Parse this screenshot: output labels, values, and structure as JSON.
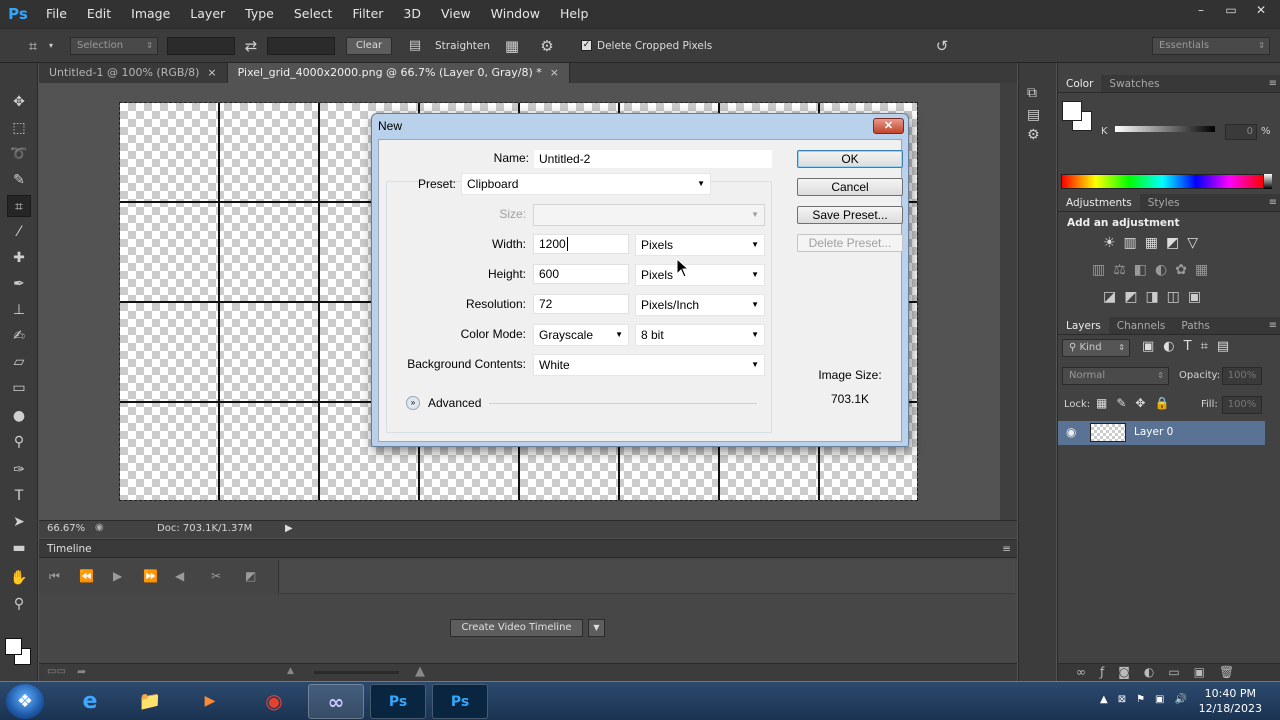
{
  "app": {
    "logo": "Ps",
    "menu": [
      "File",
      "Edit",
      "Image",
      "Layer",
      "Type",
      "Select",
      "Filter",
      "3D",
      "View",
      "Window",
      "Help"
    ],
    "window_controls": [
      "–",
      "▭",
      "✕"
    ]
  },
  "options_bar": {
    "ratio_select": "Selection",
    "clear_label": "Clear",
    "straighten_label": "Straighten",
    "delete_cropped_label": "Delete Cropped Pixels",
    "delete_cropped_checked": true,
    "workspace": "Essentials"
  },
  "doc_tabs": [
    {
      "label": "Untitled-1 @ 100% (RGB/8)",
      "close": "×"
    },
    {
      "label": "Pixel_grid_4000x2000.png @ 66.7% (Layer 0, Gray/8) *",
      "close": "×"
    }
  ],
  "status": {
    "zoom": "66.67%",
    "doc": "Doc: 703.1K/1.37M"
  },
  "timeline": {
    "title": "Timeline",
    "create_button": "Create Video Timeline"
  },
  "panels": {
    "color_tabs": [
      "Color",
      "Swatches"
    ],
    "color_channel": "K",
    "color_value": "0",
    "color_unit": "%",
    "adjust_tabs": [
      "Adjustments",
      "Styles"
    ],
    "add_adjustment": "Add an adjustment",
    "layers_tabs": [
      "Layers",
      "Channels",
      "Paths"
    ],
    "kind_label": "Kind",
    "blend_mode": "Normal",
    "opacity_label": "Opacity:",
    "opacity_value": "100%",
    "lock_label": "Lock:",
    "fill_label": "Fill:",
    "fill_value": "100%",
    "layer_name": "Layer 0"
  },
  "dialog": {
    "title": "New",
    "close": "✕",
    "name_label": "Name:",
    "name_value": "Untitled-2",
    "preset_label": "Preset:",
    "preset_value": "Clipboard",
    "size_label": "Size:",
    "size_value": "",
    "width_label": "Width:",
    "width_value": "1200",
    "width_unit": "Pixels",
    "height_label": "Height:",
    "height_value": "600",
    "height_unit": "Pixels",
    "resolution_label": "Resolution:",
    "resolution_value": "72",
    "resolution_unit": "Pixels/Inch",
    "color_mode_label": "Color Mode:",
    "color_mode_value": "Grayscale",
    "bit_depth_value": "8 bit",
    "background_label": "Background Contents:",
    "background_value": "White",
    "advanced_label": "Advanced",
    "ok_label": "OK",
    "cancel_label": "Cancel",
    "save_preset_label": "Save Preset...",
    "delete_preset_label": "Delete Preset...",
    "image_size_label": "Image Size:",
    "image_size_value": "703.1K"
  },
  "taskbar": {
    "start": "❖",
    "apps": [
      "e",
      "📁",
      "▶",
      "◉",
      "∞",
      "Ps",
      "Ps"
    ],
    "time": "10:40 PM",
    "date": "12/18/2023"
  },
  "colors": {
    "ps_blue": "#31a8ff",
    "dialog_frame": "#b9d1ea",
    "layer_selected": "#5a7395"
  }
}
